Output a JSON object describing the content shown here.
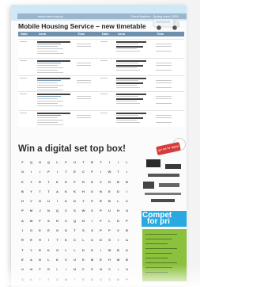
{
  "website": "www.mebo.org.uk",
  "issue_line": "Rural Matters · Spring issue 2009",
  "timetable": {
    "title": "Mobile Housing Service – new timetable",
    "headers": [
      "Date",
      "Area",
      "Time",
      "Date",
      "Area",
      "Time"
    ]
  },
  "promo": {
    "headline": "Win a digital set top box!",
    "tag": "get set for digital"
  },
  "wordsearch": {
    "rows": [
      [
        "F",
        "Q",
        "H",
        "Q",
        "L",
        "F",
        "U",
        "T",
        "B",
        "T",
        "I",
        "I",
        "L"
      ],
      [
        "G",
        "I",
        "I",
        "P",
        "I",
        "T",
        "E",
        "C",
        "F",
        "I",
        "W",
        "T",
        "I"
      ],
      [
        "K",
        "Y",
        "R",
        "T",
        "K",
        "E",
        "F",
        "R",
        "E",
        "Z",
        "R",
        "B",
        "B"
      ],
      [
        "B",
        "Y",
        "T",
        "T",
        "A",
        "K",
        "K",
        "H",
        "S",
        "N",
        "E",
        "D",
        "I"
      ],
      [
        "H",
        "V",
        "H",
        "U",
        "I",
        "K",
        "D",
        "Y",
        "P",
        "R",
        "B",
        "L",
        "C"
      ],
      [
        "P",
        "M",
        "J",
        "N",
        "Q",
        "C",
        "S",
        "W",
        "X",
        "P",
        "U",
        "H",
        "O"
      ],
      [
        "A",
        "W",
        "F",
        "S",
        "H",
        "C",
        "Q",
        "N",
        "I",
        "F",
        "L",
        "D",
        "P"
      ],
      [
        "I",
        "O",
        "E",
        "E",
        "G",
        "D",
        "T",
        "S",
        "S",
        "P",
        "P",
        "X",
        "B"
      ],
      [
        "R",
        "E",
        "H",
        "I",
        "T",
        "K",
        "C",
        "L",
        "O",
        "D",
        "S",
        "I",
        "A"
      ],
      [
        "T",
        "Y",
        "R",
        "K",
        "G",
        "L",
        "L",
        "D",
        "D",
        "I",
        "W",
        "B",
        "A"
      ],
      [
        "E",
        "A",
        "N",
        "L",
        "K",
        "C",
        "U",
        "E",
        "M",
        "E",
        "H",
        "W",
        "B"
      ],
      [
        "N",
        "W",
        "P",
        "B",
        "L",
        "I",
        "M",
        "E",
        "R",
        "M",
        "S",
        "I",
        "N"
      ],
      [
        "S",
        "K",
        "T",
        "T",
        "O",
        "M",
        "T",
        "E",
        "B",
        "S",
        "S",
        "B",
        "P"
      ]
    ]
  },
  "competition": {
    "line1": "Compet",
    "line2": "for pri"
  },
  "colors": {
    "header_blue": "#6c90ad",
    "competition_blue": "#29a8e1",
    "panel_green": "#8bc13c",
    "tag_red": "#d63b3b"
  }
}
